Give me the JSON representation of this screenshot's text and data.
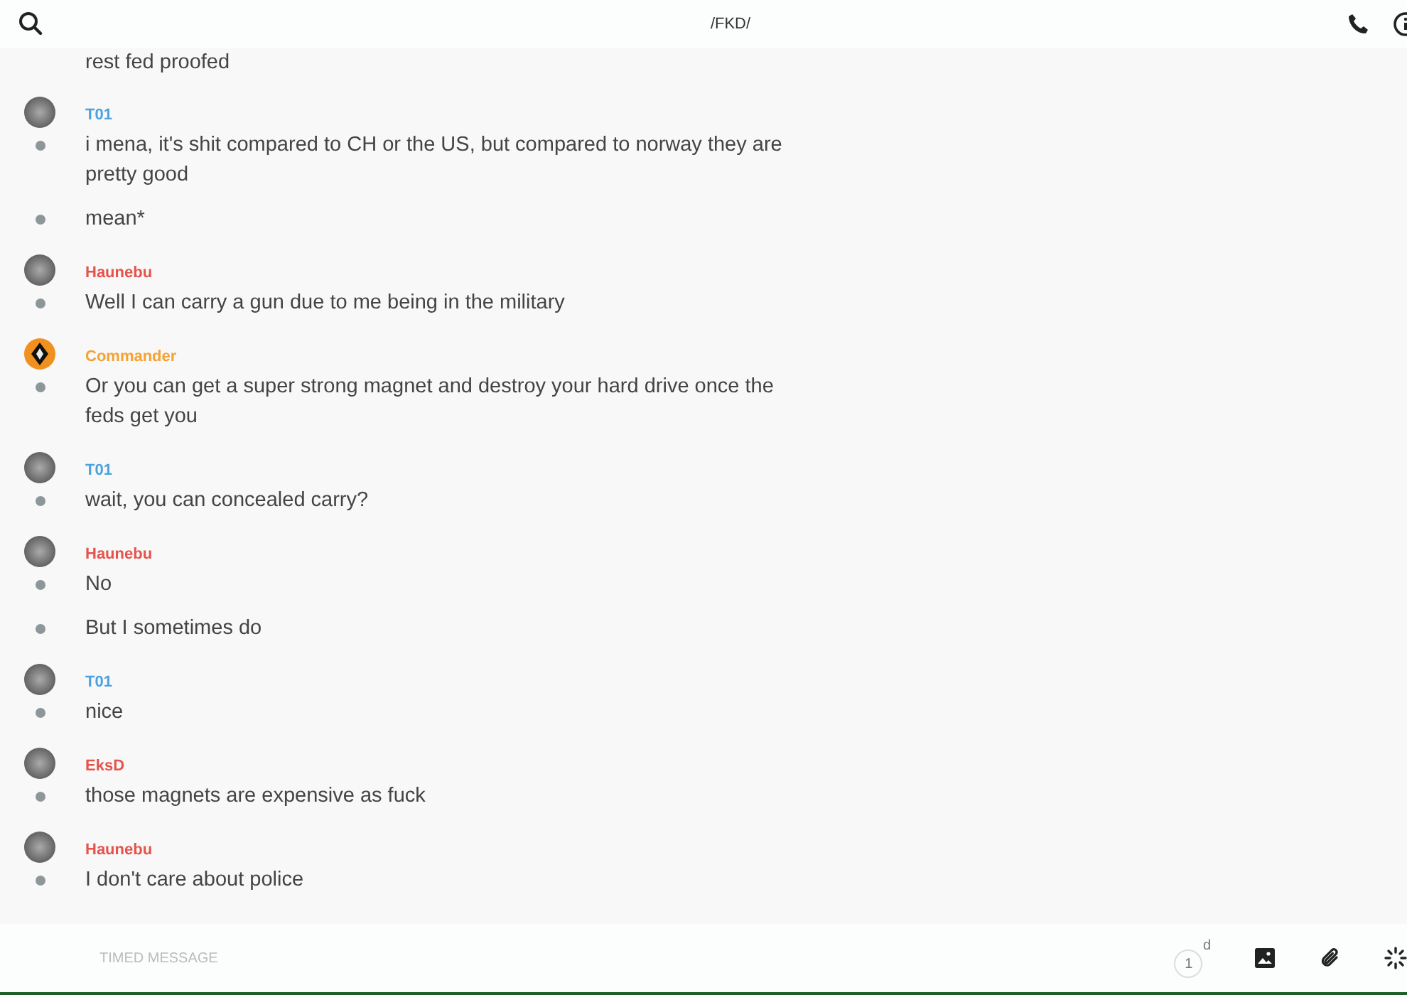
{
  "header": {
    "title": "/FKD/"
  },
  "partial_top": "rest fed proofed",
  "groups": [
    {
      "author": "T01",
      "color": "#4aa3df",
      "kind": "photo",
      "messages": [
        "i mena, it's shit compared to CH or the  US, but compared to norway they are pretty good",
        "mean*"
      ]
    },
    {
      "author": "Haunebu",
      "color": "#e5534b",
      "kind": "photo",
      "messages": [
        "Well I can carry a gun due to me being in the military"
      ]
    },
    {
      "author": "Commander",
      "color": "#f5a234",
      "kind": "emblem",
      "messages": [
        "Or you can get a super strong magnet and destroy your hard drive once the feds get you"
      ]
    },
    {
      "author": "T01",
      "color": "#4aa3df",
      "kind": "photo",
      "messages": [
        "wait, you can concealed carry?"
      ]
    },
    {
      "author": "Haunebu",
      "color": "#e5534b",
      "kind": "photo",
      "messages": [
        "No",
        "But I sometimes do"
      ]
    },
    {
      "author": "T01",
      "color": "#4aa3df",
      "kind": "photo",
      "messages": [
        "nice"
      ]
    },
    {
      "author": "EksD",
      "color": "#e5534b",
      "kind": "photo",
      "messages": [
        "those magnets are expensive as fuck"
      ]
    },
    {
      "author": "Haunebu",
      "color": "#e5534b",
      "kind": "photo",
      "messages": [
        "I don't care about police"
      ]
    }
  ],
  "composer": {
    "placeholder": "TIMED MESSAGE",
    "timer": "1",
    "timer_unit": "d"
  }
}
